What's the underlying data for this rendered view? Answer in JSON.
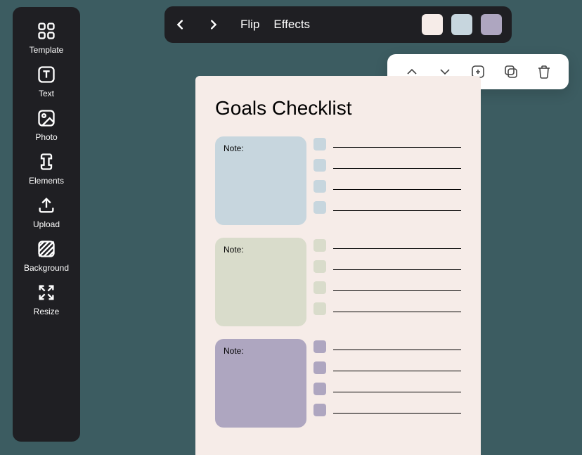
{
  "sidebar": {
    "items": [
      {
        "label": "Template"
      },
      {
        "label": "Text"
      },
      {
        "label": "Photo"
      },
      {
        "label": "Elements"
      },
      {
        "label": "Upload"
      },
      {
        "label": "Background"
      },
      {
        "label": "Resize"
      }
    ]
  },
  "toolbar": {
    "flip_label": "Flip",
    "effects_label": "Effects",
    "swatches": [
      "#f6ece8",
      "#c7d6de",
      "#aea6c0"
    ]
  },
  "document": {
    "title": "Goals Checklist",
    "sections": [
      {
        "note_label": "Note:",
        "color": "blue",
        "lines": 4
      },
      {
        "note_label": "Note:",
        "color": "green",
        "lines": 4
      },
      {
        "note_label": "Note:",
        "color": "purple",
        "lines": 4
      }
    ]
  }
}
